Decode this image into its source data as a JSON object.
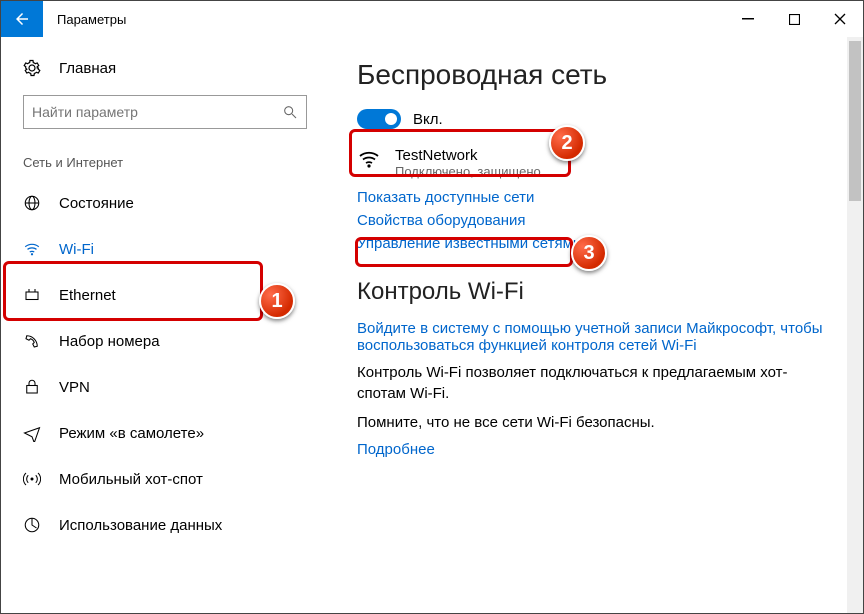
{
  "window": {
    "title": "Параметры"
  },
  "sidebar": {
    "home_label": "Главная",
    "search_placeholder": "Найти параметр",
    "section_label": "Сеть и Интернет",
    "items": [
      {
        "label": "Состояние"
      },
      {
        "label": "Wi-Fi"
      },
      {
        "label": "Ethernet"
      },
      {
        "label": "Набор номера"
      },
      {
        "label": "VPN"
      },
      {
        "label": "Режим «в самолете»"
      },
      {
        "label": "Мобильный хот-спот"
      },
      {
        "label": "Использование данных"
      }
    ]
  },
  "main": {
    "heading_wifi": "Беспроводная сеть",
    "toggle_label": "Вкл.",
    "network": {
      "name": "TestNetwork",
      "status": "Подключено, защищено"
    },
    "link_show_networks": "Показать доступные сети",
    "link_hw_properties": "Свойства оборудования",
    "link_known_networks": "Управление известными сетями",
    "heading_control": "Контроль Wi-Fi",
    "link_signin": "Войдите в систему с помощью учетной записи Майкрософт, чтобы воспользоваться функцией контроля сетей Wi-Fi",
    "control_desc": "Контроль Wi-Fi позволяет подключаться к предлагаемым хот-спотам Wi-Fi.",
    "control_warn": "Помните, что не все сети Wi-Fi безопасны.",
    "link_more": "Подробнее"
  },
  "annotations": {
    "b1": "1",
    "b2": "2",
    "b3": "3"
  }
}
